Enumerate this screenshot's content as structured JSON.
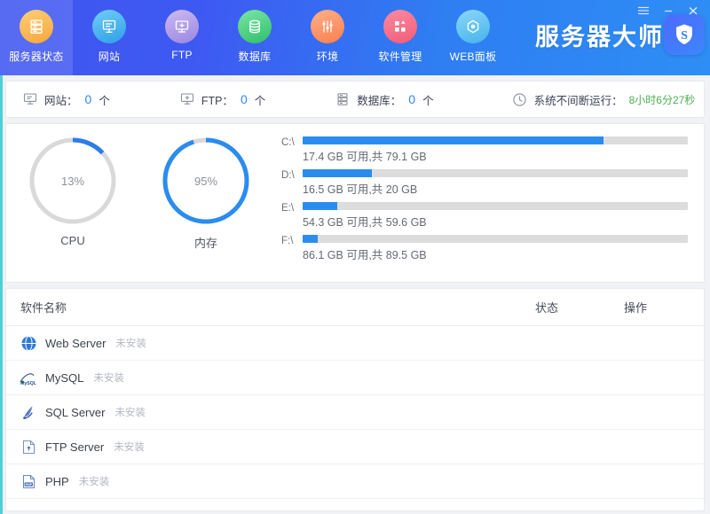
{
  "window": {
    "menu_icon": "hamburger-icon",
    "minimize_icon": "minimize-icon",
    "close_icon": "close-icon"
  },
  "brand": {
    "title": "服务器大师",
    "logo_letter": "S",
    "logo_icon": "shield-icon"
  },
  "nav": {
    "tabs": [
      {
        "label": "服务器状态",
        "icon": "server-status-icon",
        "active": true,
        "color1": "#ffc966",
        "color2": "#f7a93a"
      },
      {
        "label": "网站",
        "icon": "website-icon",
        "active": false,
        "color1": "#5fc6f5",
        "color2": "#2f9fe8"
      },
      {
        "label": "FTP",
        "icon": "ftp-icon",
        "active": false,
        "color1": "#c9b6ee",
        "color2": "#9a86e0"
      },
      {
        "label": "数据库",
        "icon": "database-icon",
        "active": false,
        "color1": "#6ede9b",
        "color2": "#35c46f"
      },
      {
        "label": "环境",
        "icon": "environment-icon",
        "active": false,
        "color1": "#ffa87a",
        "color2": "#fb7f4e"
      },
      {
        "label": "软件管理",
        "icon": "software-icon",
        "active": false,
        "color1": "#fb8096",
        "color2": "#f25b77"
      },
      {
        "label": "WEB面板",
        "icon": "web-panel-icon",
        "active": false,
        "color1": "#7fd2f7",
        "color2": "#45b3ec"
      }
    ]
  },
  "statbar": {
    "items": [
      {
        "icon": "monitor-icon",
        "label": "网站：",
        "value": "0",
        "unit": "个"
      },
      {
        "icon": "ftp-small-icon",
        "label": "FTP：",
        "value": "0",
        "unit": "个"
      },
      {
        "icon": "db-small-icon",
        "label": "数据库：",
        "value": "0",
        "unit": "个"
      }
    ],
    "uptime": {
      "icon": "clock-icon",
      "label": "系统不间断运行：",
      "value": "8小时6分27秒"
    }
  },
  "gauges": [
    {
      "name": "CPU",
      "percent": 13,
      "display": "13%",
      "track": "#d9d9d9",
      "fill": "#2b7ee8"
    },
    {
      "name": "内存",
      "percent": 95,
      "display": "95%",
      "track": "#d9d9d9",
      "fill": "#2b8cf0"
    }
  ],
  "disks": [
    {
      "name": "C:\\",
      "used_percent": 78,
      "info": "17.4 GB 可用,共 79.1 GB"
    },
    {
      "name": "D:\\",
      "used_percent": 18,
      "info": "16.5 GB 可用,共 20 GB"
    },
    {
      "name": "E:\\",
      "used_percent": 9,
      "info": "54.3 GB 可用,共 59.6 GB"
    },
    {
      "name": "F:\\",
      "used_percent": 4,
      "info": "86.1 GB 可用,共 89.5 GB"
    }
  ],
  "software_table": {
    "headers": {
      "name": "软件名称",
      "status": "状态",
      "action": "操作"
    },
    "rows": [
      {
        "name": "Web Server",
        "status": "未安装",
        "icon": "globe-icon"
      },
      {
        "name": "MySQL",
        "status": "未安装",
        "icon": "mysql-icon"
      },
      {
        "name": "SQL Server",
        "status": "未安装",
        "icon": "sqlserver-icon"
      },
      {
        "name": "FTP Server",
        "status": "未安装",
        "icon": "ftpserver-icon"
      },
      {
        "name": "PHP",
        "status": "未安装",
        "icon": "php-icon"
      }
    ]
  },
  "colors": {
    "accent": "#2b8cf0",
    "nav_gradient_start": "#3f56f0",
    "nav_gradient_end": "#2e8ef5",
    "rail": "#4ecfd8",
    "uptime_green": "#4caf50"
  }
}
